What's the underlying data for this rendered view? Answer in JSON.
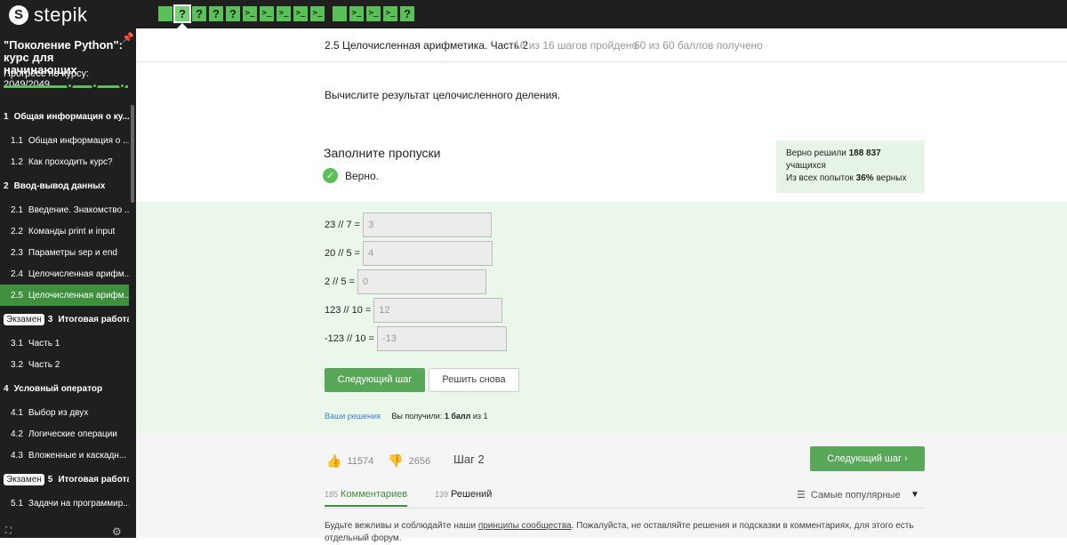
{
  "app": {
    "logo_mark": "S",
    "logo_text": "stepik"
  },
  "steps": [
    {
      "glyph": "",
      "type": "text"
    },
    {
      "glyph": "?",
      "type": "quiz",
      "active": true
    },
    {
      "glyph": "?",
      "type": "quiz"
    },
    {
      "glyph": "?",
      "type": "quiz"
    },
    {
      "glyph": "?",
      "type": "quiz"
    },
    {
      "glyph": ">_",
      "type": "code"
    },
    {
      "glyph": ">_",
      "type": "code"
    },
    {
      "glyph": ">_",
      "type": "code"
    },
    {
      "glyph": ">_",
      "type": "code"
    },
    {
      "glyph": ">_",
      "type": "code"
    },
    {
      "glyph": "",
      "type": "text"
    },
    {
      "glyph": ">_",
      "type": "code"
    },
    {
      "glyph": ">_",
      "type": "code"
    },
    {
      "glyph": ">_",
      "type": "code"
    },
    {
      "glyph": "?",
      "type": "quiz"
    }
  ],
  "sidebar": {
    "course_title": "\"Поколение Python\": курс для начинающих",
    "progress_label": "Прогресс по курсу:",
    "progress_value": "2049/2049",
    "progress_fraction": 1.0,
    "items": [
      {
        "kind": "section",
        "number": "1",
        "label": "Общая информация о ку..."
      },
      {
        "kind": "lesson",
        "number": "1.1",
        "label": "Общая информация о ..."
      },
      {
        "kind": "lesson",
        "number": "1.2",
        "label": "Как проходить курс?"
      },
      {
        "kind": "section",
        "number": "2",
        "label": "Ввод-вывод данных"
      },
      {
        "kind": "lesson",
        "number": "2.1",
        "label": "Введение. Знакомство ..."
      },
      {
        "kind": "lesson",
        "number": "2.2",
        "label": "Команды print и input"
      },
      {
        "kind": "lesson",
        "number": "2.3",
        "label": "Параметры sep и end"
      },
      {
        "kind": "lesson",
        "number": "2.4",
        "label": "Целочисленная арифм..."
      },
      {
        "kind": "lesson",
        "number": "2.5",
        "label": "Целочисленная арифм...",
        "active": true
      },
      {
        "kind": "section",
        "badge": "Экзамен",
        "number": "3",
        "label": "Итоговая работа..."
      },
      {
        "kind": "lesson",
        "number": "3.1",
        "label": "Часть 1"
      },
      {
        "kind": "lesson",
        "number": "3.2",
        "label": "Часть 2"
      },
      {
        "kind": "section",
        "number": "4",
        "label": "Условный оператор"
      },
      {
        "kind": "lesson",
        "number": "4.1",
        "label": "Выбор из двух"
      },
      {
        "kind": "lesson",
        "number": "4.2",
        "label": "Логические операции"
      },
      {
        "kind": "lesson",
        "number": "4.3",
        "label": "Вложенные и каскадн..."
      },
      {
        "kind": "section",
        "badge": "Экзамен",
        "number": "5",
        "label": "Итоговая работа..."
      },
      {
        "kind": "lesson",
        "number": "5.1",
        "label": "Задачи на программир..."
      }
    ]
  },
  "header": {
    "lesson_title": "2.5 Целочисленная арифметика. Часть 2",
    "steps_done": "16 из 16 шагов пройдено",
    "points": "60 из 60 баллов  получено"
  },
  "task": {
    "text": "Вычислите результат целочисленного деления.",
    "fill_title": "Заполните пропуски",
    "verdict": "Верно."
  },
  "stats": {
    "line1_prefix": "Верно решили",
    "line1_value": "188 837",
    "line2": "учащихся",
    "line3_prefix": "Из всех попыток",
    "line3_value": "36%",
    "line3_suffix": "верных"
  },
  "questions": [
    {
      "expr": "23 // 7 =",
      "value": "3"
    },
    {
      "expr": "20 // 5 =",
      "value": "4"
    },
    {
      "expr": "2 // 5 =",
      "value": "0"
    },
    {
      "expr": "123 // 10 =",
      "value": "12"
    },
    {
      "expr": "-123 // 10 =",
      "value": "-13"
    }
  ],
  "buttons": {
    "next_step": "Следующий шаг",
    "solve_again": "Решить снова",
    "next_step_footer": "Следующий шаг"
  },
  "result": {
    "your_solutions": "Ваши решения",
    "received_prefix": "Вы получили:",
    "received_value": "1 балл",
    "received_suffix": "из 1"
  },
  "footer": {
    "likes": "11574",
    "dislikes": "2656",
    "step_label": "Шаг 2",
    "tabs": [
      {
        "count": "185",
        "label": "Комментариев",
        "active": true
      },
      {
        "count": "139",
        "label": "Решений",
        "active": false
      }
    ],
    "sort_label": "Самые популярные",
    "rules_prefix": "Будьте вежливы и соблюдайте наши",
    "rules_link": "принципы сообщества",
    "rules_suffix": ". Пожалуйста, не оставляйте решения и подсказки в комментариях, для этого есть отдельный форум."
  },
  "colors": {
    "accent": "#59c158",
    "button": "#59a758",
    "sidebar": "#1f1f1f",
    "panel": "#ebf7ea"
  }
}
